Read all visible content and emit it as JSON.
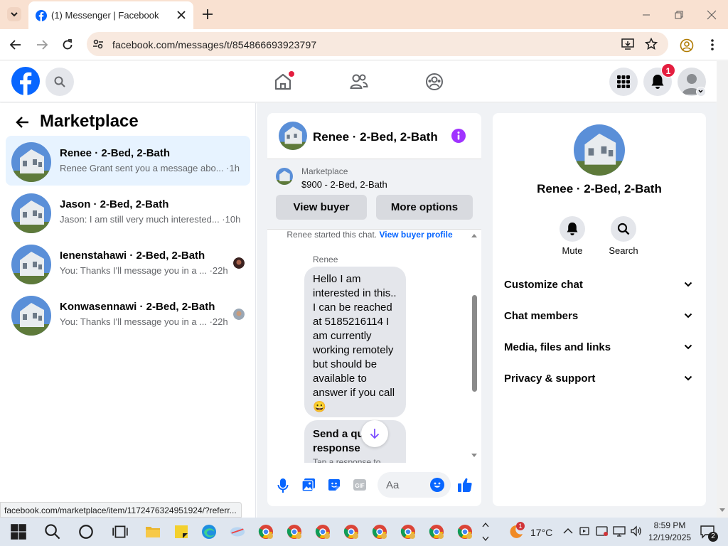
{
  "browser": {
    "tab_title": "(1) Messenger | Facebook",
    "url": "facebook.com/messages/t/854866693923797",
    "status_url": "facebook.com/marketplace/item/1172476324951924/?referr..."
  },
  "header": {
    "notification_count": "1"
  },
  "left": {
    "title": "Marketplace",
    "conversations": [
      {
        "name": "Renee · 2-Bed, 2-Bath",
        "snippet": "Renee Grant sent you a message abo... ·1h"
      },
      {
        "name": "Jason · 2-Bed, 2-Bath",
        "snippet": "Jason: I am still very much interested... ·10h"
      },
      {
        "name": "Ienenstahawi · 2-Bed, 2-Bath",
        "snippet": "You: Thanks I'll message you in a ... ·22h"
      },
      {
        "name": "Konwasennawi · 2-Bed, 2-Bath",
        "snippet": "You: Thanks I'll message you in a ... ·22h"
      }
    ]
  },
  "chat": {
    "title": "Renee · 2-Bed, 2-Bath",
    "listing_source": "Marketplace",
    "listing_title": "$900 - 2-Bed, 2-Bath",
    "view_buyer": "View buyer",
    "more_options": "More options",
    "started_text": "Renee started this chat.",
    "view_profile": "View buyer profile",
    "sender": "Renee",
    "message_lines": [
      "Hello I am",
      "interested in this..",
      "I can be reached",
      "at 5185216114 I",
      "am currently",
      "working remotely",
      "but should be",
      "available to",
      "answer if you call"
    ],
    "emoji": "😀",
    "quick_title": "Send a qu",
    "quick_title2": "response",
    "quick_sub": "Tap a response to",
    "input_placeholder": "Aa"
  },
  "info": {
    "title": "Renee · 2-Bed, 2-Bath",
    "mute": "Mute",
    "search": "Search",
    "sections": [
      "Customize chat",
      "Chat members",
      "Media, files and links",
      "Privacy & support"
    ]
  },
  "taskbar": {
    "weather": "17°C",
    "weather_badge": "1",
    "time": "8:59 PM",
    "date": "12/19/2025",
    "notif_count": "2"
  },
  "colors": {
    "fb_blue": "#0866ff",
    "messenger_purple": "#a033ff",
    "active_bg": "#e7f3ff",
    "badge_red": "#e41e3f"
  }
}
